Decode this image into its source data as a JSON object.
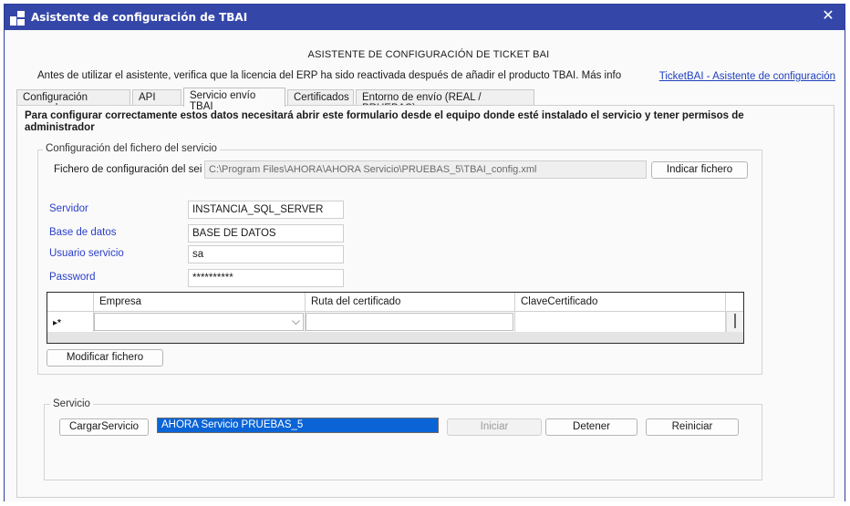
{
  "window": {
    "title": "Asistente de configuración de TBAI",
    "close_glyph": "✕"
  },
  "header": {
    "heading": "ASISTENTE DE CONFIGURACIÓN DE TICKET BAI",
    "info": "Antes de utilizar el asistente, verifica que la licencia del ERP ha sido reactivada después de añadir el producto TBAI. Más info",
    "link": "TicketBAI - Asistente de configuración"
  },
  "tabs": [
    {
      "label": "Configuración general"
    },
    {
      "label": "API"
    },
    {
      "label": "Servicio envío TBAI",
      "active": true
    },
    {
      "label": "Certificados"
    },
    {
      "label": "Entorno de envío (REAL / PRUEBAS)"
    }
  ],
  "panel": {
    "warning": "Para configurar correctamente estos datos necesitará abrir este formulario desde el equipo donde esté instalado el servicio y tener permisos de administrador",
    "config_group": {
      "title": "Configuración del fichero del servicio",
      "file_label": "Fichero de configuración del sei",
      "file_value": "C:\\Program Files\\AHORA\\AHORA Servicio\\PRUEBAS_5\\TBAI_config.xml",
      "browse_button": "Indicar fichero",
      "fields": [
        {
          "label": "Servidor",
          "value": "INSTANCIA_SQL_SERVER"
        },
        {
          "label": "Base de datos",
          "value": "BASE DE DATOS"
        },
        {
          "label": "Usuario servicio",
          "value": "sa"
        },
        {
          "label": "Password",
          "value": "**********"
        }
      ],
      "grid": {
        "columns": [
          "Empresa",
          "Ruta del certificado",
          "ClaveCertificado"
        ],
        "new_row_marker": "▸*",
        "dropdown_glyph": "⌵"
      },
      "modify_button": "Modificar fichero"
    },
    "service_group": {
      "title": "Servicio",
      "load_button": "CargarServicio",
      "service_name": "AHORA Servicio PRUEBAS_5",
      "start_button": "Iniciar",
      "stop_button": "Detener",
      "restart_button": "Reiniciar"
    }
  },
  "colors": {
    "titlebar": "#3446a8",
    "label_blue": "#2b3fc8",
    "link": "#1f3fbf",
    "selection": "#0a64d6"
  },
  "icons": [
    "app-icon",
    "close-icon",
    "dropdown-chevron-icon"
  ]
}
